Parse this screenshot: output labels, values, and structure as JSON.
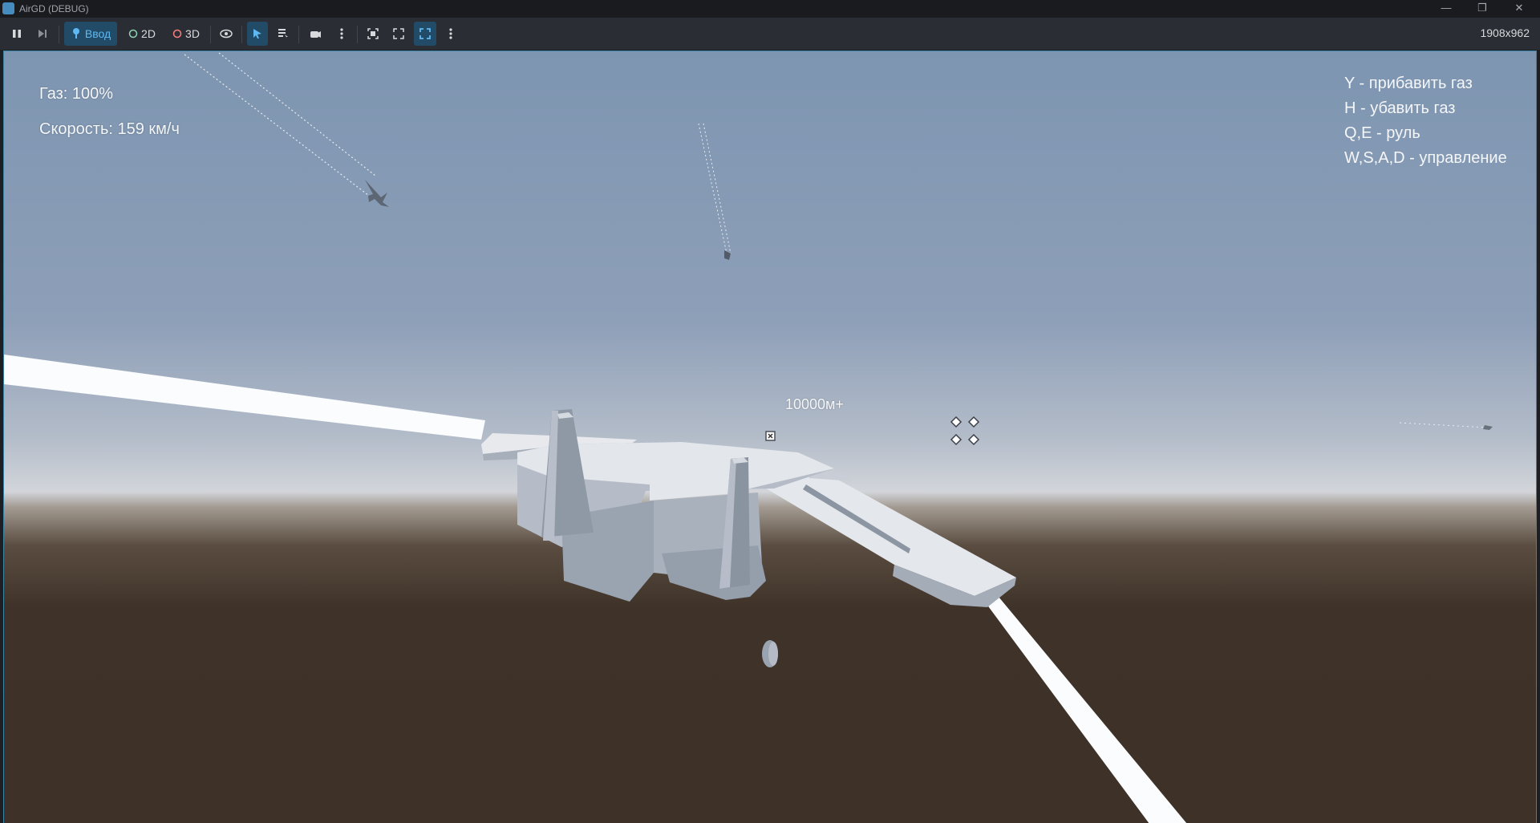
{
  "window": {
    "title": "AirGD (DEBUG)"
  },
  "toolbar": {
    "input_label": "Ввод",
    "mode_2d_label": "2D",
    "mode_3d_label": "3D",
    "resolution": "1908x962"
  },
  "hud": {
    "gas": "Газ: 100%",
    "speed": "Скорость: 159 км/ч",
    "distance": "10000м+"
  },
  "help": {
    "lines": [
      "Y - прибавить газ",
      "H - убавить газ",
      "Q,E - руль",
      "W,S,A,D - управление"
    ]
  },
  "colors": {
    "accent": "#5fb8f2",
    "sky_top": "#7f97b2",
    "ground": "#3d3128"
  }
}
